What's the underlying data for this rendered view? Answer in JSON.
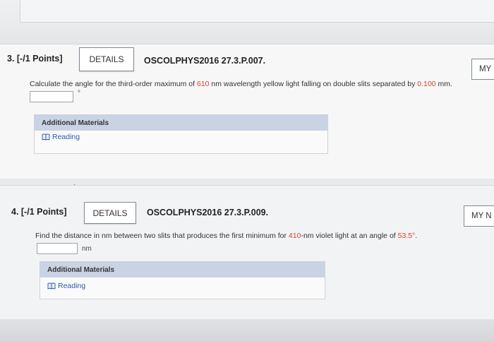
{
  "questions": [
    {
      "header": "3. [-/1 Points]",
      "details_label": "DETAILS",
      "problem_id": "OSCOLPHYS2016 27.3.P.007.",
      "my_notes_label": "MY",
      "prompt_pre": "Calculate the angle for the third-order maximum of ",
      "value1": "610",
      "prompt_mid": " nm wavelength yellow light falling on double slits separated by ",
      "value2": "0.100",
      "prompt_post": " mm.",
      "unit": "°",
      "materials_title": "Additional Materials",
      "reading_label": "Reading"
    },
    {
      "header": "4. [-/1 Points]",
      "details_label": "DETAILS",
      "problem_id": "OSCOLPHYS2016 27.3.P.009.",
      "my_notes_label": "MY N",
      "prompt_pre": "Find the distance in nm between two slits that produces the first minimum for ",
      "value1": "410",
      "prompt_mid": "-nm violet light at an angle of ",
      "value2": "53.5°",
      "prompt_post": ".",
      "unit": "nm",
      "materials_title": "Additional Materials",
      "reading_label": "Reading"
    }
  ],
  "colors": {
    "highlight": "#d4402f",
    "link": "#2a5aa8",
    "materials_header": "#c9d3e4"
  },
  "icons": [
    "book-icon",
    "cursor-icon"
  ]
}
